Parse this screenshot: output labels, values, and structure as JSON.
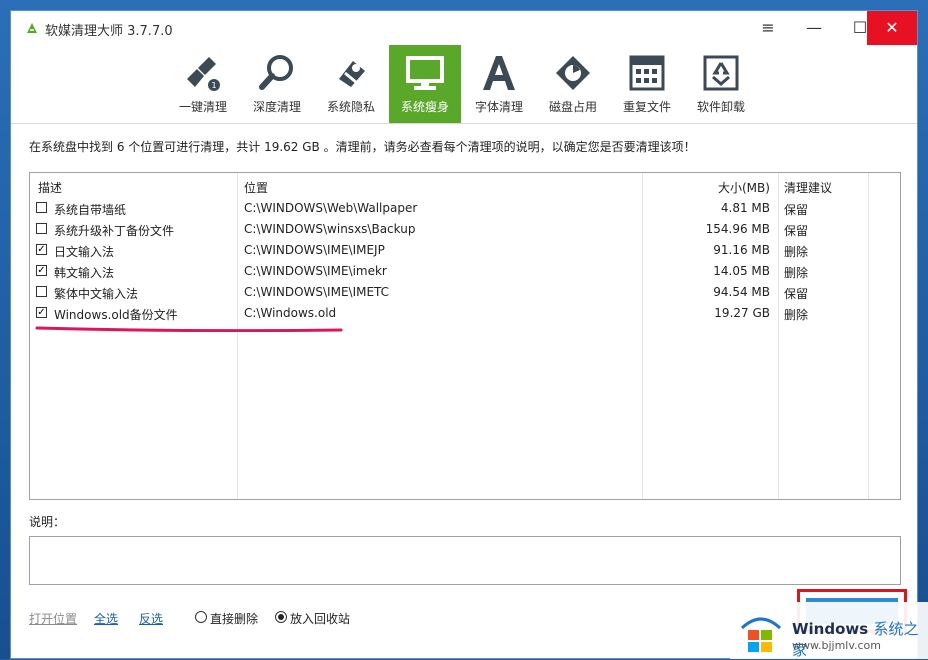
{
  "window": {
    "title": "软媒清理大师 3.7.7.0"
  },
  "titlebar": {
    "menu_glyph": "≡",
    "min_glyph": "—",
    "max_glyph": "☐",
    "close_glyph": "✕"
  },
  "toolbar": {
    "items": [
      {
        "label": "一键清理",
        "icon": "broom-icon"
      },
      {
        "label": "深度清理",
        "icon": "magnifier-icon"
      },
      {
        "label": "系统隐私",
        "icon": "privacy-eraser-icon"
      },
      {
        "label": "系统瘦身",
        "icon": "monitor-icon"
      },
      {
        "label": "字体清理",
        "icon": "font-a-icon"
      },
      {
        "label": "磁盘占用",
        "icon": "disk-chart-icon"
      },
      {
        "label": "重复文件",
        "icon": "calendar-grid-icon"
      },
      {
        "label": "软件卸载",
        "icon": "recycle-icon"
      }
    ],
    "active_index": 3,
    "active_color": "#5aa82a"
  },
  "summary": "在系统盘中找到 6 个位置可进行清理，共计 19.62 GB 。清理前，请务必查看每个清理项的说明，以确定您是否要清理该项！",
  "table": {
    "headers": {
      "desc": "描述",
      "path": "位置",
      "size": "大小(MB)",
      "advice": "清理建议"
    },
    "rows": [
      {
        "checked": false,
        "desc": "系统自带墙纸",
        "path": "C:\\WINDOWS\\Web\\Wallpaper",
        "size": "4.81 MB",
        "advice": "保留"
      },
      {
        "checked": false,
        "desc": "系统升级补丁备份文件",
        "path": "C:\\WINDOWS\\winsxs\\Backup",
        "size": "154.96 MB",
        "advice": "保留"
      },
      {
        "checked": true,
        "desc": "日文输入法",
        "path": "C:\\WINDOWS\\IME\\IMEJP",
        "size": "91.16 MB",
        "advice": "删除"
      },
      {
        "checked": true,
        "desc": "韩文输入法",
        "path": "C:\\WINDOWS\\IME\\imekr",
        "size": "14.05 MB",
        "advice": "删除"
      },
      {
        "checked": false,
        "desc": "繁体中文输入法",
        "path": "C:\\WINDOWS\\IME\\IMETC",
        "size": "94.54 MB",
        "advice": "保留"
      },
      {
        "checked": true,
        "desc": "Windows.old备份文件",
        "path": "C:\\Windows.old",
        "size": "19.27 GB",
        "advice": "删除"
      }
    ],
    "check_glyph": "✓",
    "highlight_color": "#e0145a"
  },
  "description": {
    "label": "说明："
  },
  "bottom": {
    "open_location": "打开位置",
    "select_all": "全选",
    "invert": "反选",
    "radio_direct": "直接删除",
    "radio_recycle": "放入回收站",
    "selected_radio": "recycle"
  },
  "watermark": {
    "brand": "Windows",
    "brand_cn": "系统之家",
    "url": "www.bjjmlv.com"
  },
  "colors": {
    "accent": "#2e8ad8",
    "close": "#e81123",
    "link": "#1a5fb4"
  }
}
